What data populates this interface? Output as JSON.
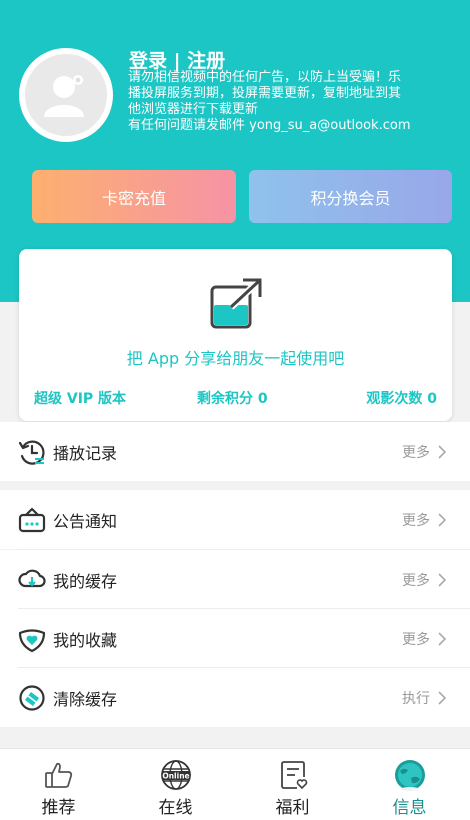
{
  "header": {
    "login_label": "登录 | 注册",
    "notice_lines": [
      "请勿相信视频中的任何广告，以防上当受骗！乐",
      "播投屏服务到期，投屏需要更新，复制地址到其",
      "他浏览器进行下载更新",
      "有任何问题请发邮件 yong_su_a@outlook.com"
    ]
  },
  "buttons": {
    "recharge": "卡密充值",
    "exchange": "积分换会员"
  },
  "share_card": {
    "share_text": "把 App 分享给朋友一起使用吧",
    "vip_label": "超级 VIP 版本",
    "points_label": "剩余积分 0",
    "views_label": "观影次数 0"
  },
  "menu": [
    {
      "label": "播放记录",
      "action": "更多",
      "icon": "history-icon"
    },
    {
      "label": "公告通知",
      "action": "更多",
      "icon": "announcement-icon"
    },
    {
      "label": "我的缓存",
      "action": "更多",
      "icon": "cache-download-icon"
    },
    {
      "label": "我的收藏",
      "action": "更多",
      "icon": "heart-icon"
    },
    {
      "label": "清除缓存",
      "action": "执行",
      "icon": "clear-cache-icon"
    }
  ],
  "tabbar": [
    {
      "label": "推荐",
      "icon": "thumbs-up-icon"
    },
    {
      "label": "在线",
      "icon": "online-globe-icon",
      "icon_text": "Online"
    },
    {
      "label": "福利",
      "icon": "gift-note-icon"
    },
    {
      "label": "信息",
      "icon": "profile-globe-icon",
      "active": true
    }
  ],
  "colors": {
    "accent": "#1cc6c4",
    "recharge_gradient": [
      "#fcb06f",
      "#f693a5"
    ],
    "exchange_gradient": [
      "#8fc2ec",
      "#98a7e9"
    ]
  }
}
